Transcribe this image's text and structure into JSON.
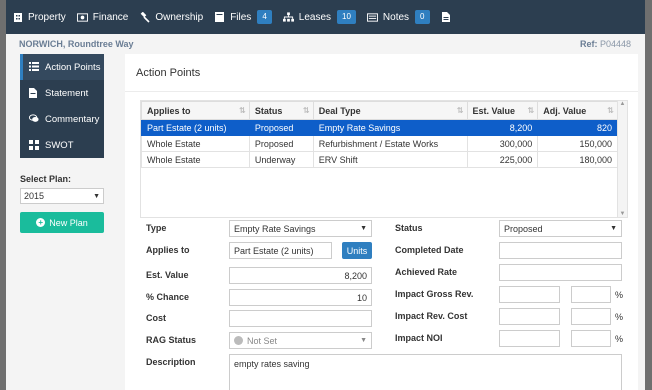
{
  "topbar": {
    "tabs": [
      {
        "label": "Property",
        "icon": "building-icon"
      },
      {
        "label": "Finance",
        "icon": "money-icon"
      },
      {
        "label": "Ownership",
        "icon": "gavel-icon"
      },
      {
        "label": "Files",
        "icon": "file-icon",
        "badge": "4"
      },
      {
        "label": "Leases",
        "icon": "sitemap-icon",
        "badge": "10"
      },
      {
        "label": "Notes",
        "icon": "notes-icon",
        "badge": "0"
      },
      {
        "label": "",
        "icon": "document-icon"
      }
    ]
  },
  "header": {
    "location": "NORWICH, Roundtree Way",
    "ref_label": "Ref:",
    "ref_value": "P04448"
  },
  "sidebar": {
    "items": [
      {
        "label": "Action Points",
        "icon": "list-icon",
        "active": true
      },
      {
        "label": "Statement",
        "icon": "doc-icon"
      },
      {
        "label": "Commentary",
        "icon": "comments-icon"
      },
      {
        "label": "SWOT",
        "icon": "grid-icon"
      }
    ],
    "select_plan_label": "Select Plan:",
    "plan_value": "2015",
    "new_plan_label": "New Plan"
  },
  "panel": {
    "title": "Action Points",
    "table": {
      "headers": [
        "Applies to",
        "Status",
        "Deal Type",
        "Est. Value",
        "Adj. Value"
      ],
      "rows": [
        {
          "applies": "Part Estate (2 units)",
          "status": "Proposed",
          "deal": "Empty Rate Savings",
          "est": "8,200",
          "adj": "820",
          "selected": true
        },
        {
          "applies": "Whole Estate",
          "status": "Proposed",
          "deal": "Refurbishment / Estate Works",
          "est": "300,000",
          "adj": "150,000"
        },
        {
          "applies": "Whole Estate",
          "status": "Underway",
          "deal": "ERV Shift",
          "est": "225,000",
          "adj": "180,000"
        }
      ]
    },
    "form": {
      "type_label": "Type",
      "type_value": "Empty Rate Savings",
      "applies_label": "Applies to",
      "applies_value": "Part Estate (2 units)",
      "units_button": "Units",
      "est_label": "Est. Value",
      "est_value": "8,200",
      "chance_label": "% Chance",
      "chance_value": "10",
      "cost_label": "Cost",
      "cost_value": "",
      "rag_label": "RAG Status",
      "rag_value": "Not Set",
      "desc_label": "Description",
      "desc_value": "empty rates saving",
      "status_label": "Status",
      "status_value": "Proposed",
      "completed_label": "Completed Date",
      "achieved_label": "Achieved Rate",
      "gross_label": "Impact Gross Rev.",
      "revcost_label": "Impact Rev. Cost",
      "noi_label": "Impact NOI",
      "pct": "%"
    }
  }
}
